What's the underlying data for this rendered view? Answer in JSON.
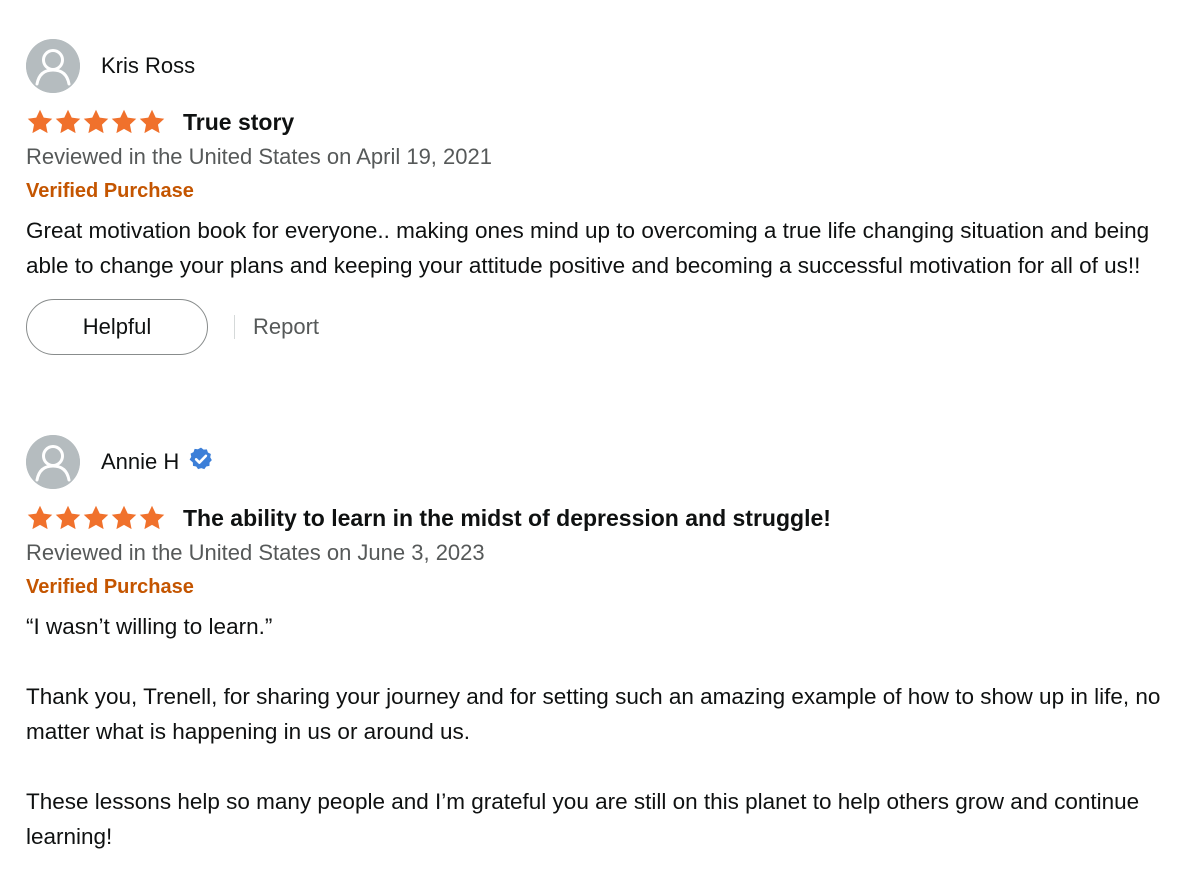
{
  "colors": {
    "star": "#f0712c",
    "verified_purchase": "#c45500",
    "secondary_text": "#565959",
    "verified_badge": "#3c7fd8",
    "avatar_bg": "#b5bcbf"
  },
  "reviews": [
    {
      "reviewer": "Kris Ross",
      "reviewer_verified_badge": false,
      "rating": 5,
      "title": "True story",
      "date_line": "Reviewed in the United States on April 19, 2021",
      "verified_label": "Verified Purchase",
      "body": [
        "Great motivation book for everyone.. making ones mind up to overcoming a true life changing situation and being able to change your plans and keeping your attitude positive and becoming a successful motivation for all of us!!"
      ],
      "helpful_label": "Helpful",
      "report_label": "Report"
    },
    {
      "reviewer": "Annie H",
      "reviewer_verified_badge": true,
      "rating": 5,
      "title": "The ability to learn in the midst of depression and struggle!",
      "date_line": "Reviewed in the United States on June 3, 2023",
      "verified_label": "Verified Purchase",
      "body": [
        "“I wasn’t willing to learn.”",
        "Thank you, Trenell, for sharing your journey and for setting such an amazing example of how to show up in life, no matter what is happening in us or around us.",
        "These lessons help so many people and I’m grateful you are still on this planet to help others grow and continue learning!"
      ]
    }
  ]
}
